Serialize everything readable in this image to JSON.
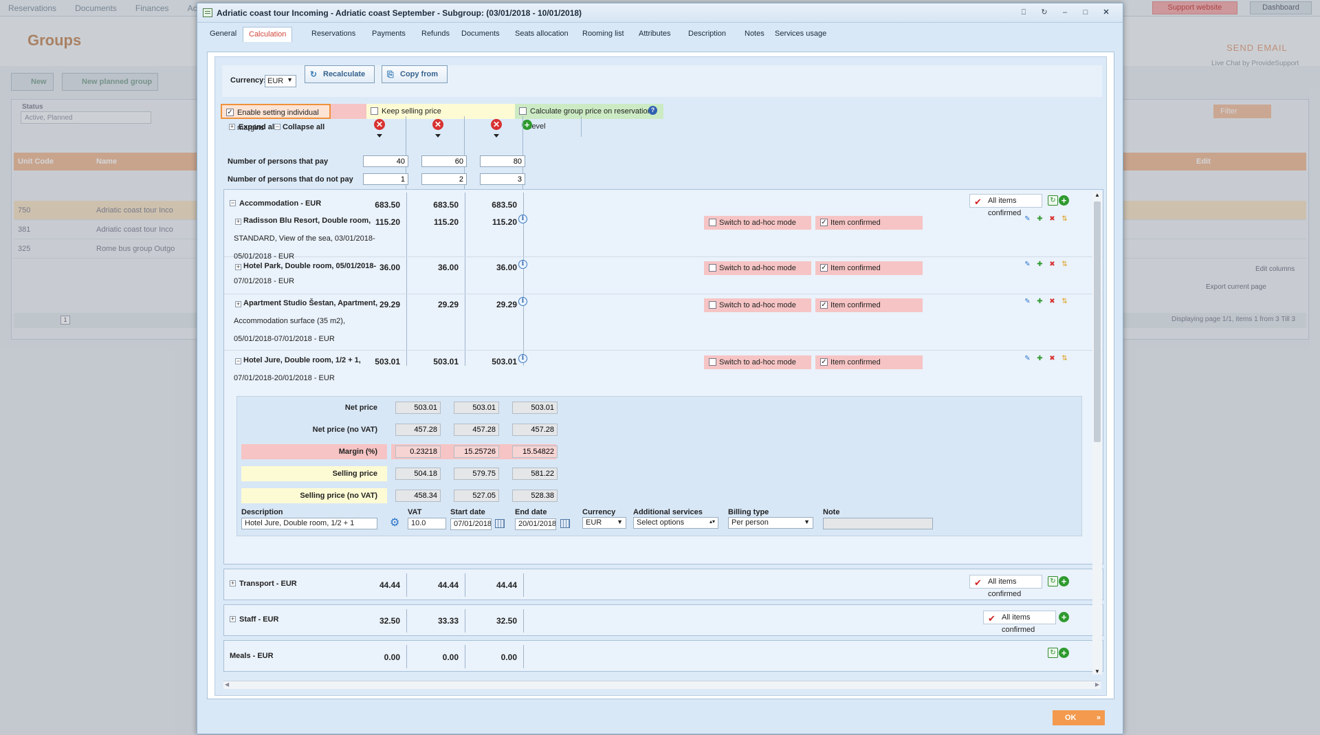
{
  "background": {
    "nav": [
      "Reservations",
      "Documents",
      "Finances",
      "Acco"
    ],
    "page_title": "Groups",
    "support_label": "Support website",
    "dashboard_label": "Dashboard",
    "send_email": "SEND EMAIL",
    "live_chat": "Live Chat by ProvideSupport",
    "new_label": "New",
    "new_planned_label": "New planned group",
    "status_label": "Status",
    "status_value": "Active, Planned",
    "filter_label": "Filter",
    "col_unit_code": "Unit Code",
    "col_name": "Name",
    "col_edit": "Edit",
    "rows": [
      {
        "code": "750",
        "name": "Adriatic coast tour Inco"
      },
      {
        "code": "381",
        "name": "Adriatic coast tour Inco"
      },
      {
        "code": "325",
        "name": "Rome bus group Outgo"
      }
    ],
    "edit_columns": "Edit columns",
    "export_label": "Export current page",
    "displaying": "Displaying page 1/1, items 1 from 3 Till 3",
    "page_num": "1"
  },
  "dialog": {
    "title": "Adriatic coast tour Incoming - Adriatic coast September - Subgroup: (03/01/2018 - 10/01/2018)",
    "tabs": [
      "General",
      "Calculation",
      "Reservations",
      "Payments",
      "Refunds",
      "Documents",
      "Seats allocation",
      "Rooming list",
      "Attributes",
      "Description",
      "Notes",
      "Services usage"
    ],
    "active_tab": "Calculation",
    "ok_label": "OK"
  },
  "toolbar": {
    "currency_label": "Currency:",
    "currency_value": "EUR",
    "recalculate": "Recalculate",
    "copy_from": "Copy from"
  },
  "options": {
    "individual_margins": "Enable setting individual margins",
    "keep_selling": "Keep selling price",
    "group_price": "Calculate group price on reservation level"
  },
  "expand_all": "Expand all /",
  "collapse_all": "Collapse all",
  "persons_pay_label": "Number of persons that pay",
  "persons_pay": [
    "40",
    "60",
    "80"
  ],
  "persons_nopay_label": "Number of persons that do not pay",
  "persons_nopay": [
    "1",
    "2",
    "3"
  ],
  "accommodation": {
    "title": "Accommodation - EUR",
    "totals": [
      "683.50",
      "683.50",
      "683.50"
    ],
    "all_confirmed": "All items confirmed",
    "items": [
      {
        "lines": [
          "Radisson Blu Resort, Double room,",
          "STANDARD, View of the sea, 03/01/2018-",
          "05/01/2018 - EUR"
        ],
        "values": [
          "115.20",
          "115.20",
          "115.20"
        ]
      },
      {
        "lines": [
          "Hotel Park, Double room, 05/01/2018-",
          "07/01/2018 - EUR"
        ],
        "values": [
          "36.00",
          "36.00",
          "36.00"
        ]
      },
      {
        "lines": [
          "Apartment Studio Šestan, Apartment,",
          "Accommodation surface (35 m2),",
          "05/01/2018-07/01/2018 - EUR"
        ],
        "values": [
          "29.29",
          "29.29",
          "29.29"
        ]
      },
      {
        "lines": [
          "Hotel Jure, Double room, 1/2 + 1,",
          "07/01/2018-20/01/2018 - EUR"
        ],
        "values": [
          "503.01",
          "503.01",
          "503.01"
        ]
      }
    ],
    "switch_adhoc": "Switch to ad-hoc mode",
    "item_confirmed": "Item confirmed"
  },
  "detail": {
    "net_price_label": "Net price",
    "net_price": [
      "503.01",
      "503.01",
      "503.01"
    ],
    "net_novat_label": "Net price (no VAT)",
    "net_novat": [
      "457.28",
      "457.28",
      "457.28"
    ],
    "margin_label": "Margin (%)",
    "margin": [
      "0.23218",
      "15.25726",
      "15.54822"
    ],
    "selling_label": "Selling price",
    "selling": [
      "504.18",
      "579.75",
      "581.22"
    ],
    "selling_novat_label": "Selling price (no VAT)",
    "selling_novat": [
      "458.34",
      "527.05",
      "528.38"
    ],
    "description_label": "Description",
    "description_value": "Hotel Jure, Double room, 1/2 + 1",
    "vat_label": "VAT",
    "vat_value": "10.0",
    "start_label": "Start date",
    "start_value": "07/01/2018",
    "end_label": "End date",
    "end_value": "20/01/2018",
    "currency_label": "Currency",
    "currency_value": "EUR",
    "additional_label": "Additional services",
    "additional_value": "Select options",
    "billing_label": "Billing type",
    "billing_value": "Per person",
    "note_label": "Note",
    "note_value": ""
  },
  "transport": {
    "title": "Transport - EUR",
    "totals": [
      "44.44",
      "44.44",
      "44.44"
    ],
    "all_confirmed": "All items confirmed"
  },
  "staff": {
    "title": "Staff - EUR",
    "totals": [
      "32.50",
      "33.33",
      "32.50"
    ],
    "all_confirmed": "All items confirmed"
  },
  "meals": {
    "title": "Meals - EUR",
    "totals": [
      "0.00",
      "0.00",
      "0.00"
    ]
  }
}
